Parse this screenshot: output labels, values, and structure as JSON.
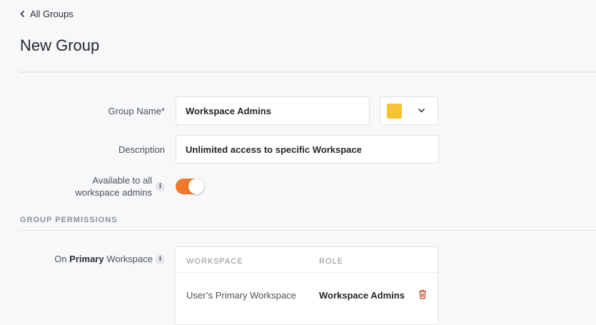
{
  "breadcrumb": {
    "back_label": "All Groups"
  },
  "page": {
    "title": "New Group"
  },
  "form": {
    "group_name_label": "Group Name*",
    "group_name_value": "Workspace Admins",
    "color_value": "#f6c332",
    "description_label": "Description",
    "description_value": "Unlimited access to specific Workspace",
    "available_label_line1": "Available to all",
    "available_label_line2": "workspace admins",
    "available_enabled": true,
    "toggle_color": "#f07a2b"
  },
  "permissions": {
    "section_title": "GROUP PERMISSIONS",
    "on_label_prefix": "On ",
    "on_label_bold": "Primary",
    "on_label_suffix": " Workspace",
    "columns": {
      "workspace": "WORKSPACE",
      "role": "ROLE"
    },
    "rows": [
      {
        "workspace": "User’s Primary Workspace",
        "role": "Workspace Admins"
      }
    ],
    "delete_icon_color": "#d0452b"
  },
  "icons": {
    "info_glyph": "i"
  }
}
